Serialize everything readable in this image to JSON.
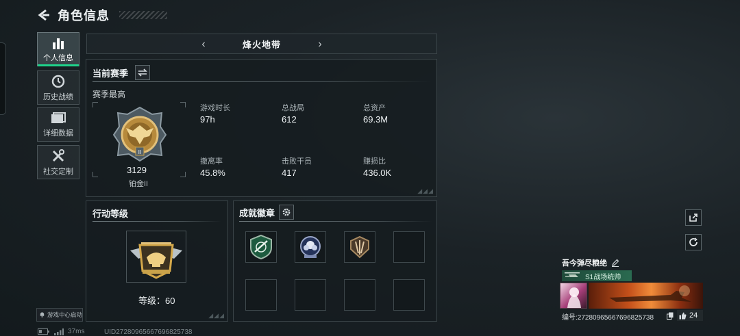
{
  "header": {
    "title": "角色信息"
  },
  "sidebar": {
    "items": [
      {
        "label": "个人信息"
      },
      {
        "label": "历史战绩"
      },
      {
        "label": "详细数据"
      },
      {
        "label": "社交定制"
      }
    ],
    "footer_button": "游戏中心启动"
  },
  "map_selector": {
    "name": "烽火地带"
  },
  "season": {
    "title": "当前赛季",
    "subtitle": "赛季最高",
    "rank_score": "3129",
    "rank_name": "铂金II",
    "stats": [
      {
        "label": "游戏时长",
        "value": "97h"
      },
      {
        "label": "总战局",
        "value": "612"
      },
      {
        "label": "总资产",
        "value": "69.3M"
      },
      {
        "label": "撤离率",
        "value": "45.8%"
      },
      {
        "label": "击败干员",
        "value": "417"
      },
      {
        "label": "赚损比",
        "value": "436.0K"
      }
    ]
  },
  "action_level": {
    "title": "行动等级",
    "level_text": "等级：60"
  },
  "achievements": {
    "title": "成就徽章"
  },
  "profile": {
    "name": "吾今弹尽粮绝",
    "title_badge": "S1战场统帅",
    "id_text": "编号:27280965667696825738",
    "likes": "24"
  },
  "status_bar": {
    "ping": "37ms",
    "uid": "UID27280965667696825738"
  },
  "colors": {
    "accent": "#1fd48b",
    "gold": "#c9a24a"
  }
}
